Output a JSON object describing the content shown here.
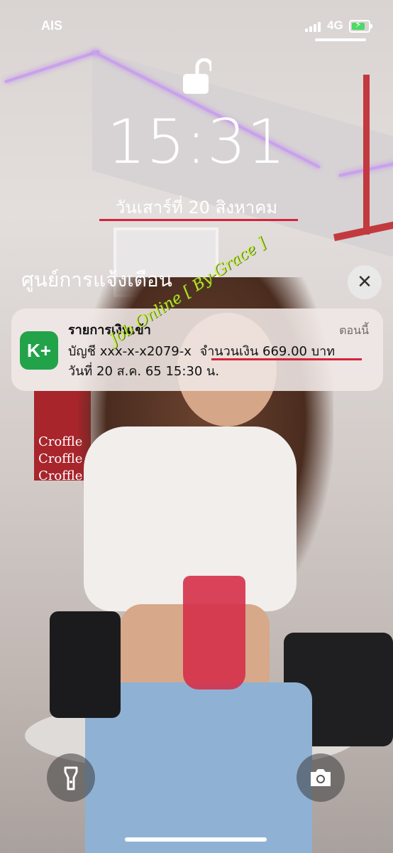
{
  "status_bar": {
    "carrier": "AIS",
    "network": "4G",
    "battery_level": 0.85,
    "battery_color": "#4cd964"
  },
  "lock": {
    "icon": "unlock-icon"
  },
  "clock": {
    "time": "15:31",
    "date": "วันเสาร์ที่ 20 สิงหาคม"
  },
  "notification_center": {
    "title": "ศูนย์การแจ้งเตือน",
    "close_icon": "close-icon"
  },
  "notification": {
    "app_icon_text": "K+",
    "app_icon_color": "#22a34a",
    "title": "รายการเงินเข้า",
    "time": "ตอนนี้",
    "account": "บัญชี xxx-x-x2079-x",
    "amount": "จำนวนเงิน 669.00 บาท",
    "date_line": "วันที่ 20 ส.ค. 65  15:30 น."
  },
  "watermark": "Job Online [ By-Grace ]",
  "background_sign": [
    "Croffle",
    "Croffle",
    "Croffle"
  ],
  "bottom_controls": {
    "flashlight_icon": "flashlight-icon",
    "camera_icon": "camera-icon"
  },
  "accent_color": "#d3233a"
}
